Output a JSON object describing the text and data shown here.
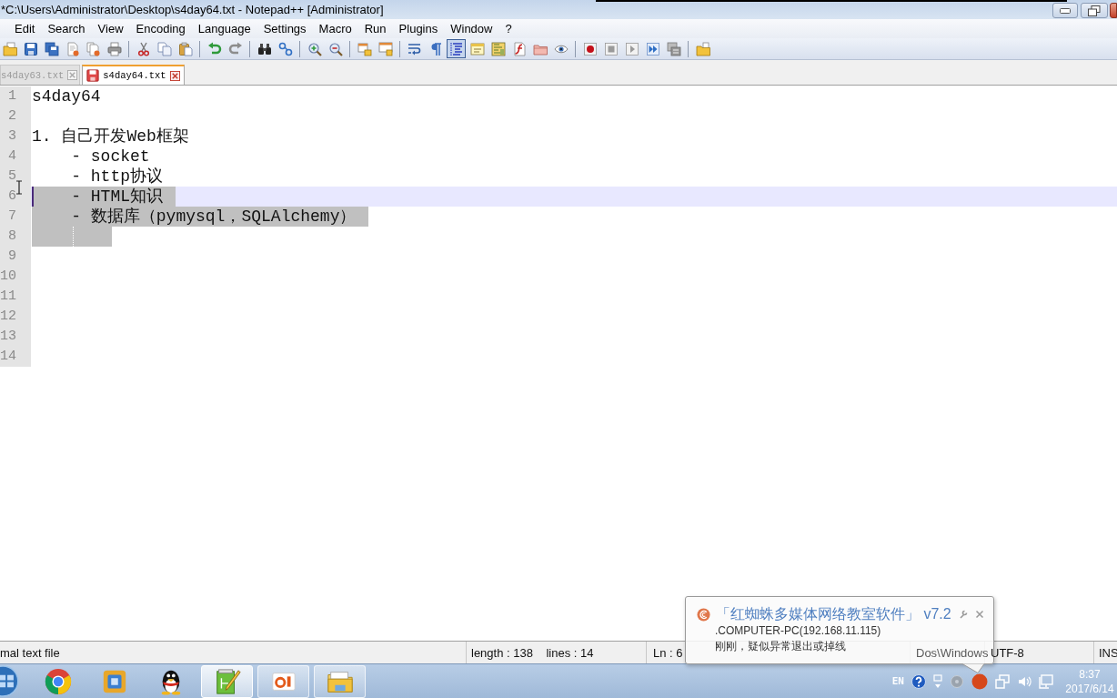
{
  "window": {
    "title": "*C:\\Users\\Administrator\\Desktop\\s4day64.txt - Notepad++ [Administrator]"
  },
  "menu": [
    "Edit",
    "Search",
    "View",
    "Encoding",
    "Language",
    "Settings",
    "Macro",
    "Run",
    "Plugins",
    "Window",
    "?"
  ],
  "toolbar": [
    [
      {
        "kind": "open",
        "pressed": false
      },
      {
        "kind": "save",
        "pressed": false
      },
      {
        "kind": "save_all",
        "pressed": false
      },
      {
        "kind": "close",
        "pressed": false
      },
      {
        "kind": "close_all",
        "pressed": false
      },
      {
        "kind": "print",
        "pressed": false
      }
    ],
    [
      {
        "kind": "cut",
        "pressed": false
      },
      {
        "kind": "copy",
        "pressed": false
      },
      {
        "kind": "paste",
        "pressed": false
      }
    ],
    [
      {
        "kind": "undo",
        "pressed": false
      },
      {
        "kind": "redo",
        "pressed": false
      }
    ],
    [
      {
        "kind": "find",
        "pressed": false
      },
      {
        "kind": "replace",
        "pressed": false
      }
    ],
    [
      {
        "kind": "zoom_in",
        "pressed": false
      },
      {
        "kind": "zoom_out",
        "pressed": false
      }
    ],
    [
      {
        "kind": "sync_v",
        "pressed": false
      },
      {
        "kind": "sync_h",
        "pressed": false
      }
    ],
    [
      {
        "kind": "wrap",
        "pressed": false
      },
      {
        "kind": "all_chars",
        "pressed": false
      },
      {
        "kind": "indent_guide",
        "pressed": true
      },
      {
        "kind": "note_window",
        "pressed": false
      },
      {
        "kind": "doc_map",
        "pressed": false
      },
      {
        "kind": "function_list",
        "pressed": false
      },
      {
        "kind": "folder_workspace",
        "pressed": false
      },
      {
        "kind": "monitor",
        "pressed": false
      }
    ],
    [
      {
        "kind": "record",
        "pressed": false
      },
      {
        "kind": "stop",
        "pressed": false
      },
      {
        "kind": "play",
        "pressed": false
      },
      {
        "kind": "play_multi",
        "pressed": false
      },
      {
        "kind": "save_macro",
        "pressed": false
      }
    ],
    [
      {
        "kind": "open_folder",
        "pressed": false
      }
    ]
  ],
  "tabs": [
    {
      "label": "s4day63.txt",
      "selected": false,
      "unsaved": false
    },
    {
      "label": "s4day64.txt",
      "selected": true,
      "unsaved": true
    }
  ],
  "editor": {
    "lines": [
      {
        "number": "1",
        "text": "s4day64",
        "selected": false,
        "current": false
      },
      {
        "number": "2",
        "selected": false,
        "current": false
      },
      {
        "number": "3",
        "text": "1. 自己开发Web框架",
        "selected": false,
        "current": false
      },
      {
        "number": "4",
        "text": "    - socket",
        "selected": false,
        "current": false
      },
      {
        "number": "5",
        "text": "    - http协议",
        "selected": false,
        "current": false
      },
      {
        "number": "6",
        "text": "    - HTML知识",
        "selected": true,
        "current": true
      },
      {
        "number": "7",
        "text": "    - 数据库（pymysql，SQLAlchemy）",
        "selected": true,
        "current": false
      },
      {
        "number": "8",
        "selected": true,
        "current": false
      },
      {
        "number": "9",
        "selected": false,
        "current": false
      },
      {
        "number": "10",
        "selected": false,
        "current": false
      },
      {
        "number": "11",
        "selected": false,
        "current": false
      },
      {
        "number": "12",
        "selected": false,
        "current": false
      },
      {
        "number": "13",
        "selected": false,
        "current": false
      },
      {
        "number": "14",
        "selected": false,
        "current": false
      }
    ]
  },
  "status_bar": [
    "mal text file",
    "length : 138    lines : 14",
    "Ln : 6",
    "Dos\\Windows",
    "UTF-8",
    "INS"
  ],
  "notification": {
    "title": "「红蜘蛛多媒体网络教室软件」 v7.2",
    "lines": [
      ".COMPUTER-PC(192.168.11.115)",
      "刚刚，疑似异常退出或掉线"
    ]
  },
  "taskbar": {
    "apps": [
      {
        "kind": "browser",
        "running": false,
        "selected": false
      },
      {
        "kind": "squares",
        "running": false,
        "selected": false
      },
      {
        "kind": "penguin",
        "running": false,
        "selected": false
      },
      {
        "kind": "notepad",
        "running": true,
        "selected": true
      },
      {
        "kind": "orange",
        "running": true,
        "selected": false
      },
      {
        "kind": "folder",
        "running": true,
        "selected": false
      }
    ],
    "language": "EN",
    "clock": {
      "time": "8:37",
      "date": "2017/6/14"
    }
  }
}
